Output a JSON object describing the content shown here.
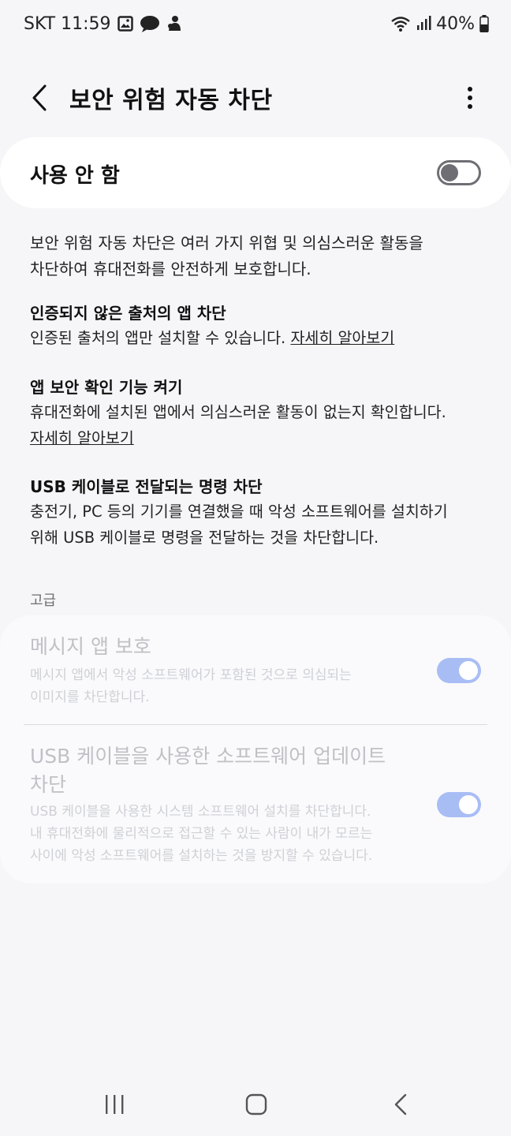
{
  "status_bar": {
    "carrier_time": "SKT 11:59",
    "battery": "40%",
    "icons": [
      "gallery-icon",
      "chat-icon",
      "notification-icon",
      "wifi-icon",
      "signal-icon",
      "battery-icon"
    ]
  },
  "app_bar": {
    "title": "보안 위험 자동 차단",
    "icons": [
      "back-icon",
      "more-vert-icon"
    ]
  },
  "master_switch": {
    "label": "사용 안 함",
    "state": "off"
  },
  "description": {
    "line1": "보안 위험 자동 차단은 여러 가지 위협 및 의심스러운 활동을",
    "line2": "차단하여 휴대전화를 안전하게 보호합니다."
  },
  "sections": [
    {
      "title": "인증되지 않은 출처의 앱 차단",
      "text": "인증된 출처의 앱만 설치할 수 있습니다. ",
      "link": "자세히 알아보기"
    },
    {
      "title": "앱 보안 확인 기능 켜기",
      "text": "휴대전화에 설치된 앱에서 의심스러운 활동이 없는지 확인합니다.",
      "link": "자세히 알아보기"
    },
    {
      "title": "USB 케이블로 전달되는 명령 차단",
      "text_line1": "충전기, PC 등의 기기를 연결했을 때 악성 소프트웨어를 설치하기",
      "text_line2": "위해 USB 케이블로 명령을 전달하는 것을 차단합니다."
    }
  ],
  "advanced": {
    "header": "고급",
    "items": [
      {
        "title": "메시지 앱 보호",
        "sub_line1": "메시지 앱에서 악성 소프트웨어가 포함된 것으로 의심되는",
        "sub_line2": "이미지를 차단합니다.",
        "state": "on"
      },
      {
        "title_line1": "USB 케이블을 사용한 소프트웨어 업데이트",
        "title_line2": "차단",
        "sub_line1": "USB 케이블을 사용한 시스템 소프트웨어 설치를 차단합니다.",
        "sub_line2": "내 휴대전화에 물리적으로 접근할 수 있는 사람이 내가 모르는",
        "sub_line3": "사이에 악성 소프트웨어를 설치하는 것을 방지할 수 있습니다.",
        "state": "on"
      }
    ]
  },
  "nav_bar": {
    "icons": [
      "recents-icon",
      "home-icon",
      "back-nav-icon"
    ]
  },
  "colors": {
    "background": "#f6f6f8",
    "card": "#ffffff",
    "toggle_on_disabled": "#a9bdf5",
    "toggle_off": "#6e6e74",
    "disabled_text": "#c0c0c6"
  }
}
